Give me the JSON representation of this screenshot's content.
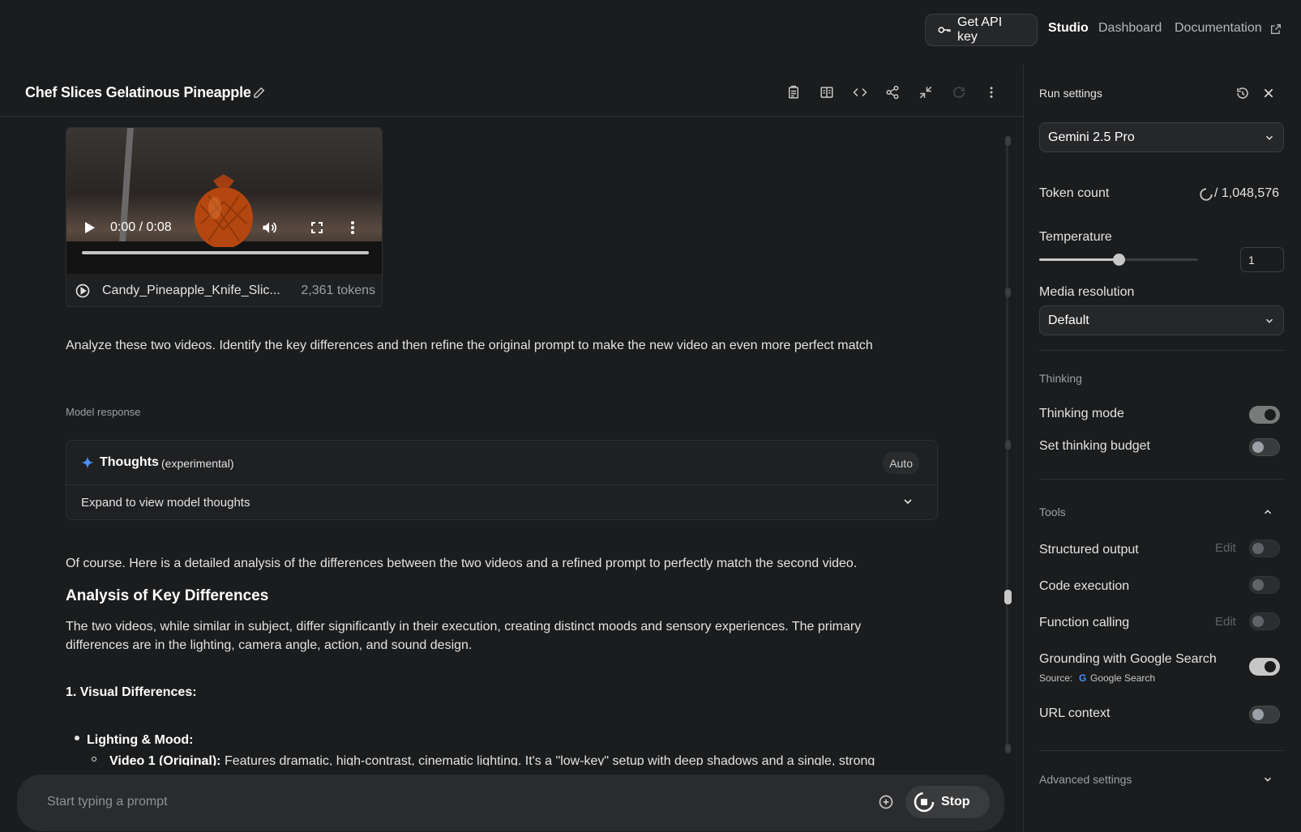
{
  "topbar": {
    "api_key_label": "Get API key",
    "nav": [
      "Studio",
      "Dashboard",
      "Documentation"
    ]
  },
  "header": {
    "title": "Chef Slices Gelatinous Pineapple"
  },
  "video": {
    "time": "0:00 / 0:08",
    "filename": "Candy_Pineapple_Knife_Slic...",
    "tokens": "2,361 tokens",
    "progress": 0
  },
  "prompt": "Analyze these two videos. Identify the key differences and then refine the original prompt to make the new video an even more perfect match",
  "model_response_label": "Model response",
  "thoughts": {
    "title": "Thoughts",
    "tag": "(experimental)",
    "auto": "Auto",
    "expand": "Expand to view model thoughts"
  },
  "response": {
    "intro": "Of course. Here is a detailed analysis of the differences between the two videos and a refined prompt to perfectly match the second video.",
    "heading": "Analysis of Key Differences",
    "para_line1": "The two videos, while similar in subject, differ significantly in their execution, creating distinct moods and sensory experiences. The primary",
    "para_line2": "differences are in the lighting, camera angle, action, and sound design.",
    "sub_heading": "1. Visual Differences:",
    "bullet1": "Lighting & Mood:",
    "sub_bullet_bold": "Video 1 (Original):",
    "sub_bullet_text": " Features dramatic, high-contrast, cinematic lighting. It's a \"low-key\" setup with deep shadows and a single, strong"
  },
  "input": {
    "placeholder": "Start typing a prompt",
    "stop_label": "Stop"
  },
  "settings": {
    "title": "Run settings",
    "model": "Gemini 2.5 Pro",
    "token_count_label": "Token count",
    "token_count_value": "/ 1,048,576",
    "temperature_label": "Temperature",
    "temperature_value": "1",
    "temperature_fraction": 0.5,
    "media_resolution_label": "Media resolution",
    "media_resolution_value": "Default",
    "thinking_section": "Thinking",
    "thinking_mode": "Thinking mode",
    "thinking_budget": "Set thinking budget",
    "tools_section": "Tools",
    "tools": {
      "structured_output": "Structured output",
      "code_execution": "Code execution",
      "function_calling": "Function calling",
      "grounding": "Grounding with Google Search",
      "grounding_source_label": "Source:",
      "grounding_source": "Google Search",
      "url_context": "URL context",
      "edit_label": "Edit"
    },
    "advanced": "Advanced settings"
  }
}
